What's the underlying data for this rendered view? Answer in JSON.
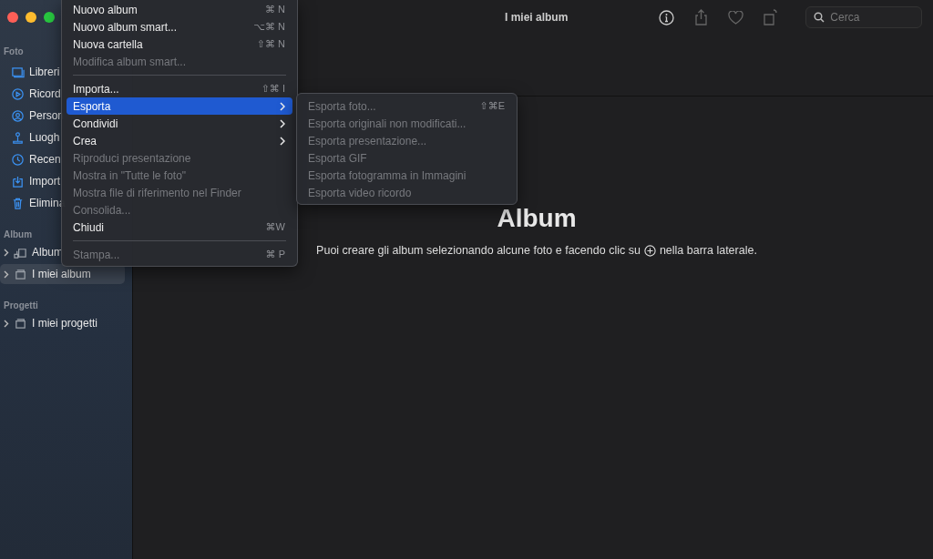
{
  "window": {
    "title": "I miei album"
  },
  "toolbar": {
    "search": {
      "placeholder": "Cerca"
    }
  },
  "sidebar": {
    "sections": [
      {
        "title": "Foto",
        "items": [
          {
            "label": "Libreri",
            "expandable": false,
            "selected": false
          },
          {
            "label": "Ricord",
            "expandable": false,
            "selected": false
          },
          {
            "label": "Person",
            "expandable": false,
            "selected": false
          },
          {
            "label": "Luogh",
            "expandable": false,
            "selected": false
          },
          {
            "label": "Recen",
            "expandable": false,
            "selected": false
          },
          {
            "label": "Import",
            "expandable": false,
            "selected": false
          },
          {
            "label": "Elimina",
            "expandable": false,
            "selected": false
          }
        ]
      },
      {
        "title": "Album",
        "items": [
          {
            "label": "Album",
            "expandable": true,
            "selected": false
          },
          {
            "label": "I miei album",
            "expandable": true,
            "selected": true
          }
        ]
      },
      {
        "title": "Progetti",
        "items": [
          {
            "label": "I miei progetti",
            "expandable": true,
            "selected": false
          }
        ]
      }
    ]
  },
  "content": {
    "heading": "Album",
    "hint_before": "Puoi creare gli album selezionando alcune foto e facendo clic su",
    "hint_after": "nella barra laterale."
  },
  "menu": {
    "items": [
      {
        "kind": "item",
        "label": "Nuovo album",
        "shortcut": "⌘ N",
        "disabled": false,
        "selected": false,
        "submenu": false
      },
      {
        "kind": "item",
        "label": "Nuovo album smart...",
        "shortcut": "⌥⌘ N",
        "disabled": false,
        "selected": false,
        "submenu": false
      },
      {
        "kind": "item",
        "label": "Nuova cartella",
        "shortcut": "⇧⌘ N",
        "disabled": false,
        "selected": false,
        "submenu": false
      },
      {
        "kind": "item",
        "label": "Modifica album smart...",
        "disabled": true,
        "selected": false,
        "submenu": false
      },
      {
        "kind": "separator"
      },
      {
        "kind": "item",
        "label": "Importa...",
        "shortcut": "⇧⌘ I",
        "disabled": false,
        "selected": false,
        "submenu": false
      },
      {
        "kind": "item",
        "label": "Esporta",
        "disabled": false,
        "selected": true,
        "submenu": true
      },
      {
        "kind": "item",
        "label": "Condividi",
        "disabled": false,
        "selected": false,
        "submenu": true
      },
      {
        "kind": "item",
        "label": "Crea",
        "disabled": false,
        "selected": false,
        "submenu": true
      },
      {
        "kind": "item",
        "label": "Riproduci presentazione",
        "disabled": true,
        "selected": false,
        "submenu": false
      },
      {
        "kind": "item",
        "label": "Mostra in \"Tutte le foto\"",
        "disabled": true,
        "selected": false,
        "submenu": false
      },
      {
        "kind": "item",
        "label": "Mostra file di riferimento nel Finder",
        "disabled": true,
        "selected": false,
        "submenu": false
      },
      {
        "kind": "item",
        "label": "Consolida...",
        "disabled": true,
        "selected": false,
        "submenu": false
      },
      {
        "kind": "item",
        "label": "Chiudi",
        "shortcut": "⌘W",
        "disabled": false,
        "selected": false,
        "submenu": false
      },
      {
        "kind": "separator"
      },
      {
        "kind": "item",
        "label": "Stampa...",
        "shortcut": "⌘ P",
        "disabled": true,
        "selected": false,
        "submenu": false
      }
    ]
  },
  "submenu": {
    "items": [
      {
        "label": "Esporta foto...",
        "shortcut": "⇧⌘E",
        "disabled": true
      },
      {
        "label": "Esporta originali non modificati...",
        "disabled": true
      },
      {
        "label": "Esporta presentazione...",
        "disabled": true
      },
      {
        "label": "Esporta GIF",
        "disabled": true
      },
      {
        "label": "Esporta fotogramma in Immagini",
        "disabled": true
      },
      {
        "label": "Esporta video ricordo",
        "disabled": true
      }
    ]
  }
}
